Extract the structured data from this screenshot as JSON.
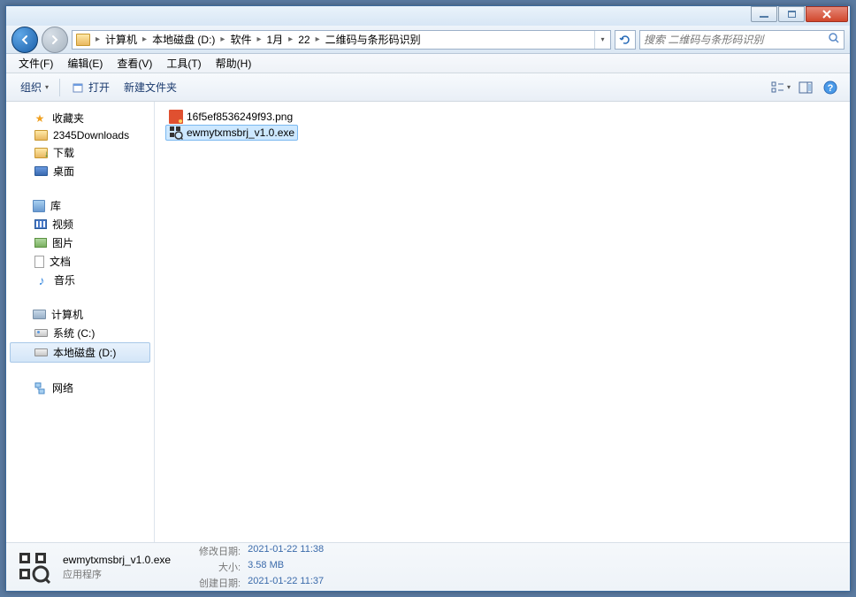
{
  "breadcrumb": {
    "items": [
      "计算机",
      "本地磁盘 (D:)",
      "软件",
      "1月",
      "22",
      "二维码与条形码识别"
    ]
  },
  "search": {
    "placeholder": "搜索 二维码与条形码识别"
  },
  "menu": {
    "file": "文件(F)",
    "edit": "编辑(E)",
    "view": "查看(V)",
    "tools": "工具(T)",
    "help": "帮助(H)"
  },
  "toolbar": {
    "organize": "组织",
    "open": "打开",
    "newfolder": "新建文件夹"
  },
  "sidebar": {
    "favorites": {
      "label": "收藏夹",
      "items": [
        "2345Downloads",
        "下载",
        "桌面"
      ]
    },
    "libraries": {
      "label": "库",
      "items": [
        "视频",
        "图片",
        "文档",
        "音乐"
      ]
    },
    "computer": {
      "label": "计算机",
      "items": [
        "系统 (C:)",
        "本地磁盘 (D:)"
      ]
    },
    "network": {
      "label": "网络"
    }
  },
  "files": {
    "items": [
      {
        "name": "16f5ef8536249f93.png",
        "type": "png",
        "selected": false
      },
      {
        "name": "ewmytxmsbrj_v1.0.exe",
        "type": "exe",
        "selected": true
      }
    ]
  },
  "details": {
    "name": "ewmytxmsbrj_v1.0.exe",
    "type": "应用程序",
    "labels": {
      "modified": "修改日期:",
      "size": "大小:",
      "created": "创建日期:"
    },
    "modified": "2021-01-22 11:38",
    "size": "3.58 MB",
    "created": "2021-01-22 11:37"
  }
}
